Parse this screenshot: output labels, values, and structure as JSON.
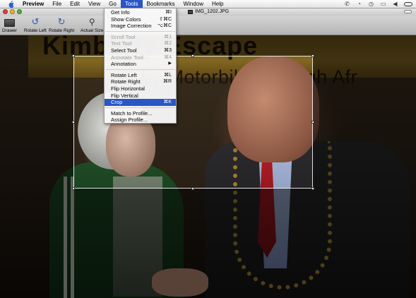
{
  "menubar": {
    "app": "Preview",
    "items": [
      "File",
      "Edit",
      "View",
      "Go",
      "Tools",
      "Bookmarks",
      "Window",
      "Help"
    ],
    "active": "Tools"
  },
  "window": {
    "title": "IMG_1202.JPG"
  },
  "toolbar": {
    "drawer": "Drawer",
    "rotate_left": "Rotate Left",
    "rotate_right": "Rotate Right",
    "actual_size": "Actual Size"
  },
  "image": {
    "banner_top": "Kimberly Escape",
    "banner_line": "by Motorbike through Afr"
  },
  "tools_menu": {
    "get_info": {
      "label": "Get Info",
      "shortcut": "⌘I"
    },
    "show_colors": {
      "label": "Show Colors",
      "shortcut": "⇧⌘C"
    },
    "image_correction": {
      "label": "Image Correction",
      "shortcut": "⌥⌘C"
    },
    "scroll_tool": {
      "label": "Scroll Tool",
      "shortcut": "⌘1"
    },
    "text_tool": {
      "label": "Text Tool",
      "shortcut": "⌘2"
    },
    "select_tool": {
      "label": "Select Tool",
      "shortcut": "⌘3"
    },
    "annotate_tool": {
      "label": "Annotate Tool",
      "shortcut": "⌘4"
    },
    "annotation": {
      "label": "Annotation"
    },
    "rotate_left": {
      "label": "Rotate Left",
      "shortcut": "⌘L"
    },
    "rotate_right": {
      "label": "Rotate Right",
      "shortcut": "⌘R"
    },
    "flip_horizontal": {
      "label": "Flip Horizontal"
    },
    "flip_vertical": {
      "label": "Flip Vertical"
    },
    "crop": {
      "label": "Crop",
      "shortcut": "⌘K"
    },
    "match_to_profile": {
      "label": "Match to Profile..."
    },
    "assign_profile": {
      "label": "Assign Profile..."
    }
  },
  "colors": {
    "selection_blue": "#2a56c6"
  }
}
